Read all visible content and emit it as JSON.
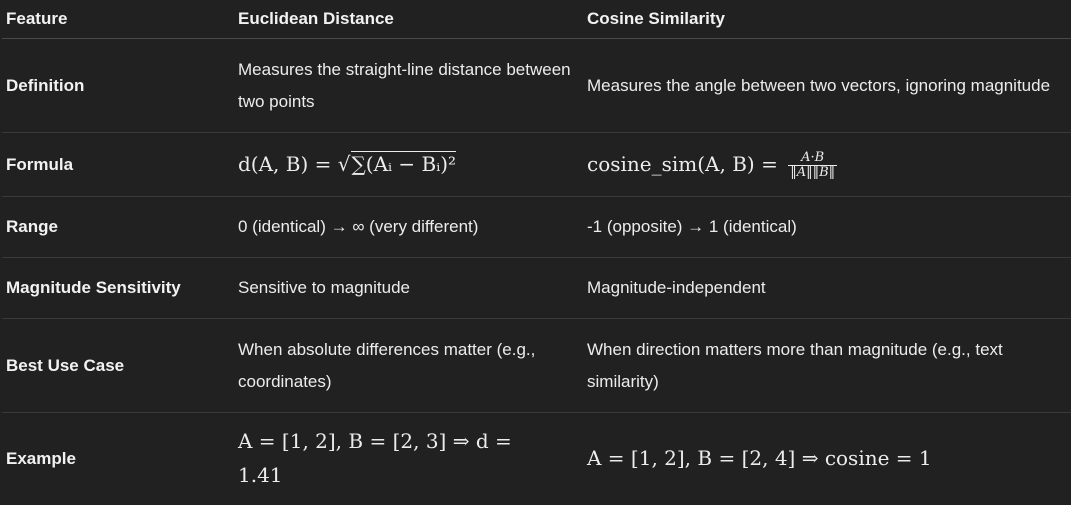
{
  "headers": [
    "Feature",
    "Euclidean Distance",
    "Cosine Similarity"
  ],
  "rows": [
    {
      "feature": "Definition",
      "euclidean": "Measures the straight-line distance between two points",
      "cosine": "Measures the angle between two vectors, ignoring magnitude"
    },
    {
      "feature": "Formula",
      "euclidean": "d(A, B) = √∑(Aᵢ − Bᵢ)²",
      "cosine": "cosine_sim(A, B) = A·B / ‖A‖‖B‖"
    },
    {
      "feature": "Range",
      "euclidean": "0 (identical) → ∞ (very different)",
      "cosine": "-1 (opposite) → 1 (identical)"
    },
    {
      "feature": "Magnitude Sensitivity",
      "euclidean": "Sensitive to magnitude",
      "cosine": "Magnitude-independent"
    },
    {
      "feature": "Best Use Case",
      "euclidean": "When absolute differences matter (e.g., coordinates)",
      "cosine": "When direction matters more than magnitude (e.g., text similarity)"
    },
    {
      "feature": "Example",
      "euclidean": "A = [1, 2], B = [2, 3] ⇒ d = 1.41",
      "cosine": "A = [1, 2], B = [2, 4] ⇒ cosine = 1"
    }
  ],
  "formula_parts": {
    "euclid_lhs": "d(A, B) =",
    "euclid_sqrt_symbol": "√",
    "euclid_radicand": "∑(Aᵢ − Bᵢ)²",
    "cos_lhs": "cosine_sim(A, B) =",
    "cos_num": "A·B",
    "cos_den": "‖A‖‖B‖"
  },
  "example_parts": {
    "euclid_line1": "A = [1, 2], B = [2, 3] ⇒ d =",
    "euclid_line2": "1.41",
    "cosine_line": "A = [1, 2], B = [2, 4] ⇒ cosine = 1"
  }
}
